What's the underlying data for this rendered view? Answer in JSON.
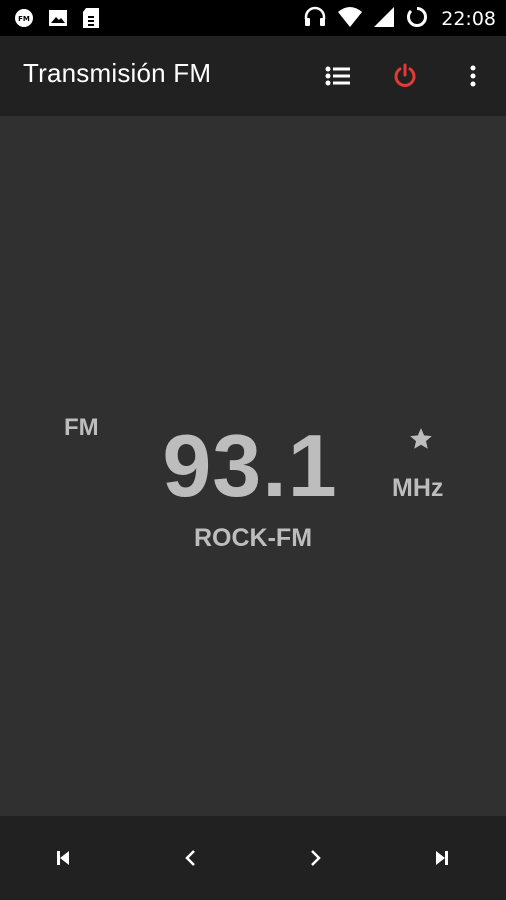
{
  "status_bar": {
    "time": "22:08",
    "left_icons": [
      "fm-radio-icon",
      "image-icon",
      "sim-icon"
    ],
    "right_icons": [
      "headset-icon",
      "wifi-icon",
      "signal-icon",
      "battery-charging-icon"
    ]
  },
  "app_bar": {
    "title": "Transmisión FM",
    "actions": [
      "station-list-icon",
      "power-icon",
      "more-vert-icon"
    ]
  },
  "player": {
    "band": "FM",
    "frequency": "93.1",
    "unit": "MHz",
    "station_name": "ROCK-FM",
    "favorite_icon": "star-icon"
  },
  "controls": {
    "icons": [
      "skip-previous-icon",
      "chevron-left-icon",
      "chevron-right-icon",
      "skip-next-icon"
    ]
  },
  "colors": {
    "status_bar_bg": "#000000",
    "app_bar_bg": "#212121",
    "main_bg": "#303030",
    "text_secondary": "#bdbdbd",
    "power_accent": "#e53935"
  }
}
